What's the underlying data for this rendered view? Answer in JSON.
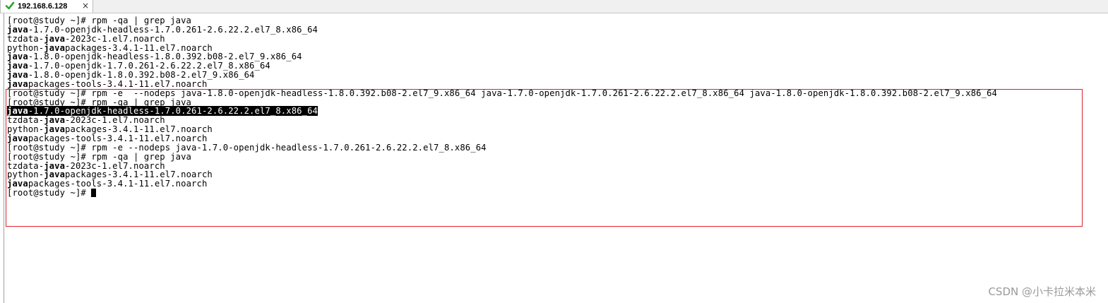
{
  "tab": {
    "label": "192.168.6.128",
    "close_glyph": "×",
    "status_icon": "green-check-icon",
    "status_color": "#2aa52a"
  },
  "terminal": {
    "lines": [
      [
        {
          "t": "[root@study ~]# rpm -qa | grep java"
        }
      ],
      [
        {
          "t": "java",
          "b": true
        },
        {
          "t": "-1.7.0-openjdk-headless-1.7.0.261-2.6.22.2.el7_8.x86_64"
        }
      ],
      [
        {
          "t": "tzdata-"
        },
        {
          "t": "java",
          "b": true
        },
        {
          "t": "-2023c-1.el7.noarch"
        }
      ],
      [
        {
          "t": "python-"
        },
        {
          "t": "java",
          "b": true
        },
        {
          "t": "packages-3.4.1-11.el7.noarch"
        }
      ],
      [
        {
          "t": "java",
          "b": true
        },
        {
          "t": "-1.8.0-openjdk-headless-1.8.0.392.b08-2.el7_9.x86_64"
        }
      ],
      [
        {
          "t": "java",
          "b": true
        },
        {
          "t": "-1.7.0-openjdk-1.7.0.261-2.6.22.2.el7_8.x86_64"
        }
      ],
      [
        {
          "t": "java",
          "b": true
        },
        {
          "t": "-1.8.0-openjdk-1.8.0.392.b08-2.el7_9.x86_64"
        }
      ],
      [
        {
          "t": "java",
          "b": true
        },
        {
          "t": "packages-tools-3.4.1-11.el7.noarch"
        }
      ],
      [
        {
          "t": "[root@study ~]# rpm -e  --nodeps java-1.8.0-openjdk-headless-1.8.0.392.b08-2.el7_9.x86_64 java-1.7.0-openjdk-1.7.0.261-2.6.22.2.el7_8.x86_64 java-1.8.0-openjdk-1.8.0.392.b08-2.el7_9.x86_64"
        }
      ],
      [
        {
          "t": "[root@study ~]# rpm -qa | grep java"
        }
      ],
      [
        {
          "t": "java",
          "b": true,
          "sel": true
        },
        {
          "t": "-1.7.0-openjdk-headless-1.7.0.261-2.6.22.2.el7_8.x86_64",
          "sel": true
        }
      ],
      [
        {
          "t": "tzdata-"
        },
        {
          "t": "java",
          "b": true
        },
        {
          "t": "-2023c-1.el7.noarch"
        }
      ],
      [
        {
          "t": "python-"
        },
        {
          "t": "java",
          "b": true
        },
        {
          "t": "packages-3.4.1-11.el7.noarch"
        }
      ],
      [
        {
          "t": "java",
          "b": true
        },
        {
          "t": "packages-tools-3.4.1-11.el7.noarch"
        }
      ],
      [
        {
          "t": "[root@study ~]# rpm -e --nodeps java-1.7.0-openjdk-headless-1.7.0.261-2.6.22.2.el7_8.x86_64"
        }
      ],
      [
        {
          "t": "[root@study ~]# rpm -qa | grep java"
        }
      ],
      [
        {
          "t": "tzdata-"
        },
        {
          "t": "java",
          "b": true
        },
        {
          "t": "-2023c-1.el7.noarch"
        }
      ],
      [
        {
          "t": "python-"
        },
        {
          "t": "java",
          "b": true
        },
        {
          "t": "packages-3.4.1-11.el7.noarch"
        }
      ],
      [
        {
          "t": "java",
          "b": true
        },
        {
          "t": "packages-tools-3.4.1-11.el7.noarch"
        }
      ],
      [
        {
          "t": "[root@study ~]# "
        },
        {
          "cursor": true
        }
      ]
    ]
  },
  "annotation": {
    "color": "#e0202a"
  },
  "watermark": {
    "text": "CSDN @小卡拉米本米"
  }
}
